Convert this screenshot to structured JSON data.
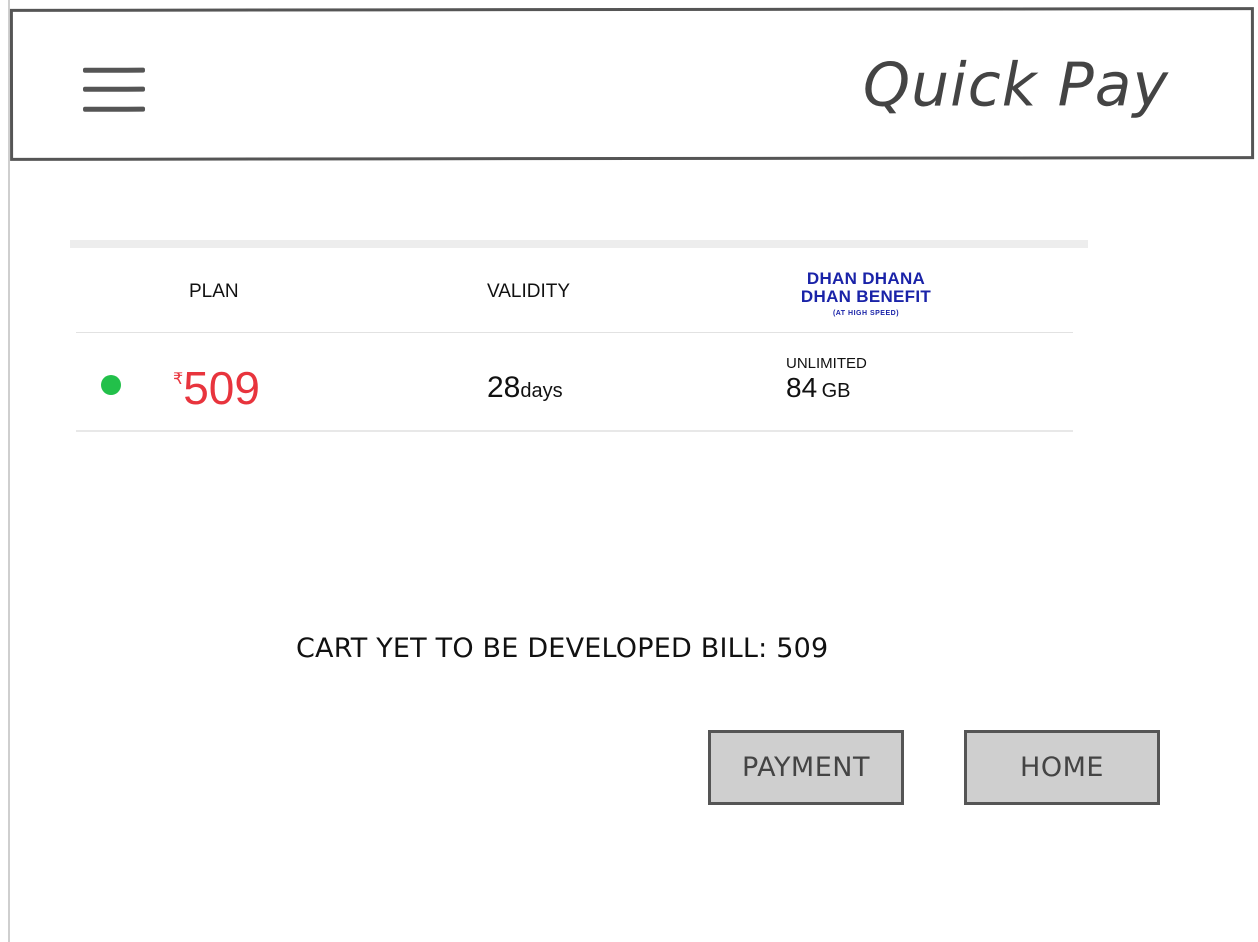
{
  "header": {
    "title": "Quick Pay",
    "menu_icon": "hamburger-menu-icon"
  },
  "plan_table": {
    "headers": {
      "plan": "PLAN",
      "validity": "VALIDITY"
    },
    "benefit_logo": {
      "line1": "DHAN DHANA",
      "line2": "DHAN BENEFIT",
      "line3": "(AT HIGH SPEED)",
      "color": "#1a23a8"
    },
    "row": {
      "status_color": "#22c04a",
      "currency_symbol": "₹",
      "price": "509",
      "price_color": "#e8343d",
      "validity_value": "28",
      "validity_unit": "days",
      "data_label": "UNLIMITED",
      "data_value": "84",
      "data_unit": "GB"
    }
  },
  "cart": {
    "text": "CART YET TO BE DEVELOPED BILL: 509"
  },
  "buttons": {
    "payment_label": "PAYMENT",
    "home_label": "HOME"
  }
}
